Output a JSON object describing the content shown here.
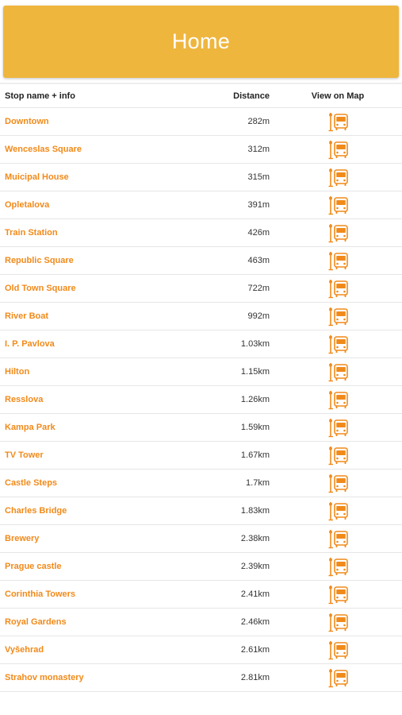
{
  "header": {
    "title": "Home"
  },
  "table": {
    "columns": {
      "name": "Stop name + info",
      "distance": "Distance",
      "map": "View on Map"
    },
    "icon": "bus-stop-icon",
    "accent": "#f18a1a",
    "header_color": "#efb63e",
    "rows": [
      {
        "name": "Downtown",
        "distance": "282m"
      },
      {
        "name": "Wenceslas Square",
        "distance": "312m"
      },
      {
        "name": "Muicipal House",
        "distance": "315m"
      },
      {
        "name": "Opletalova",
        "distance": "391m"
      },
      {
        "name": "Train Station",
        "distance": "426m"
      },
      {
        "name": "Republic Square",
        "distance": "463m"
      },
      {
        "name": "Old Town Square",
        "distance": "722m"
      },
      {
        "name": "River Boat",
        "distance": "992m"
      },
      {
        "name": "I. P. Pavlova",
        "distance": "1.03km"
      },
      {
        "name": "Hilton",
        "distance": "1.15km"
      },
      {
        "name": "Resslova",
        "distance": "1.26km"
      },
      {
        "name": "Kampa Park",
        "distance": "1.59km"
      },
      {
        "name": "TV Tower",
        "distance": "1.67km"
      },
      {
        "name": "Castle Steps",
        "distance": "1.7km"
      },
      {
        "name": "Charles Bridge",
        "distance": "1.83km"
      },
      {
        "name": "Brewery",
        "distance": "2.38km"
      },
      {
        "name": "Prague castle",
        "distance": "2.39km"
      },
      {
        "name": "Corinthia Towers",
        "distance": "2.41km"
      },
      {
        "name": "Royal Gardens",
        "distance": "2.46km"
      },
      {
        "name": "Vyšehrad",
        "distance": "2.61km"
      },
      {
        "name": "Strahov monastery",
        "distance": "2.81km"
      }
    ]
  }
}
